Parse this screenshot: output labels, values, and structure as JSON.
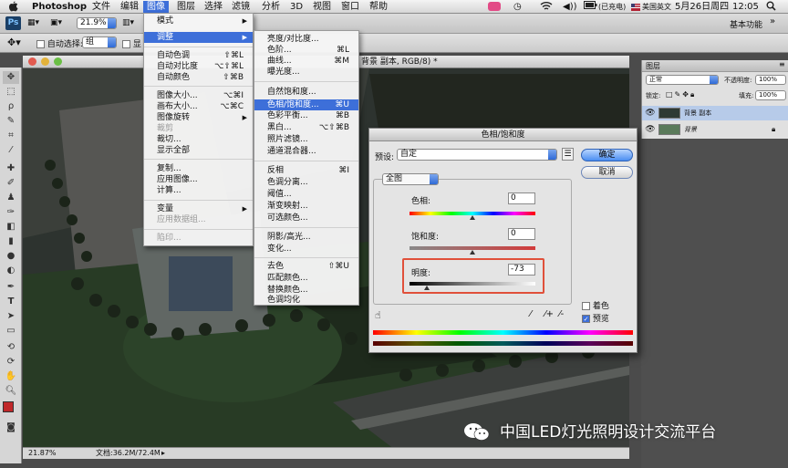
{
  "menubar": {
    "apple": "",
    "app": "Photoshop",
    "items": [
      "文件",
      "编辑",
      "图像",
      "图层",
      "选择",
      "滤镜",
      "分析",
      "3D",
      "视图",
      "窗口",
      "帮助"
    ],
    "selected": "图像",
    "charging": "(已充电)",
    "input_method": "美国英文",
    "date": "5月26日周四",
    "time": "12:05",
    "ps_badge": "Ps",
    "zoom_select": "21.9%",
    "workspace": "基本功能"
  },
  "options": {
    "auto_select_label": "自动选择:",
    "auto_select_value": "组",
    "show_transform": "显"
  },
  "document": {
    "title_suffix": "背景 副本, RGB/8) *",
    "zoom": "21.87%",
    "doc_size": "文档:36.2M/72.4M"
  },
  "image_menu": {
    "items": [
      {
        "label": "模式",
        "sc": "",
        "arrow": true
      },
      {
        "label": "调整",
        "sc": "",
        "arrow": true,
        "hl": true
      },
      {
        "label": "自动色调",
        "sc": "⇧⌘L"
      },
      {
        "label": "自动对比度",
        "sc": "⌥⇧⌘L"
      },
      {
        "label": "自动颜色",
        "sc": "⇧⌘B"
      },
      {
        "label": "图像大小...",
        "sc": "⌥⌘I"
      },
      {
        "label": "画布大小...",
        "sc": "⌥⌘C"
      },
      {
        "label": "图像旋转",
        "sc": "",
        "arrow": true
      },
      {
        "label": "裁剪",
        "sc": "",
        "dis": true
      },
      {
        "label": "裁切...",
        "sc": ""
      },
      {
        "label": "显示全部",
        "sc": ""
      },
      {
        "label": "复制...",
        "sc": ""
      },
      {
        "label": "应用图像...",
        "sc": ""
      },
      {
        "label": "计算...",
        "sc": ""
      },
      {
        "label": "变量",
        "sc": "",
        "arrow": true
      },
      {
        "label": "应用数据组...",
        "sc": "",
        "dis": true
      },
      {
        "label": "陷印...",
        "sc": "",
        "dis": true
      }
    ]
  },
  "adjust_menu": {
    "items": [
      {
        "label": "亮度/对比度...",
        "sc": ""
      },
      {
        "label": "色阶...",
        "sc": "⌘L"
      },
      {
        "label": "曲线...",
        "sc": "⌘M"
      },
      {
        "label": "曝光度...",
        "sc": ""
      },
      {
        "label": "自然饱和度...",
        "sc": ""
      },
      {
        "label": "色相/饱和度...",
        "sc": "⌘U",
        "hl": true
      },
      {
        "label": "色彩平衡...",
        "sc": "⌘B"
      },
      {
        "label": "黑白...",
        "sc": "⌥⇧⌘B"
      },
      {
        "label": "照片滤镜...",
        "sc": ""
      },
      {
        "label": "通道混合器...",
        "sc": ""
      },
      {
        "label": "反相",
        "sc": "⌘I"
      },
      {
        "label": "色调分离...",
        "sc": ""
      },
      {
        "label": "阈值...",
        "sc": ""
      },
      {
        "label": "渐变映射...",
        "sc": ""
      },
      {
        "label": "可选颜色...",
        "sc": ""
      },
      {
        "label": "阴影/高光...",
        "sc": ""
      },
      {
        "label": "变化...",
        "sc": ""
      },
      {
        "label": "去色",
        "sc": "⇧⌘U"
      },
      {
        "label": "匹配颜色...",
        "sc": ""
      },
      {
        "label": "替换颜色...",
        "sc": ""
      },
      {
        "label": "色调均化",
        "sc": ""
      }
    ]
  },
  "dialog": {
    "title": "色相/饱和度",
    "preset_label": "预设:",
    "preset_value": "自定",
    "ok": "确定",
    "cancel": "取消",
    "channel": "全图",
    "hue_label": "色相:",
    "hue_value": "0",
    "sat_label": "饱和度:",
    "sat_value": "0",
    "light_label": "明度:",
    "light_value": "-73",
    "colorize": "着色",
    "preview": "预览"
  },
  "layers": {
    "tab": "图层",
    "blend_mode": "正常",
    "opacity_label": "不透明度:",
    "opacity_value": "100%",
    "lock_label": "锁定:",
    "fill_label": "填充:",
    "fill_value": "100%",
    "items": [
      {
        "name": "背景 副本",
        "selected": true
      },
      {
        "name": "背景",
        "selected": false
      }
    ]
  },
  "watermark": "中国LED灯光照明设计交流平台",
  "colors": {
    "menu_highlight": "#3d6fd9",
    "red_box": "#e0503a",
    "foreground": "#c0282a"
  }
}
